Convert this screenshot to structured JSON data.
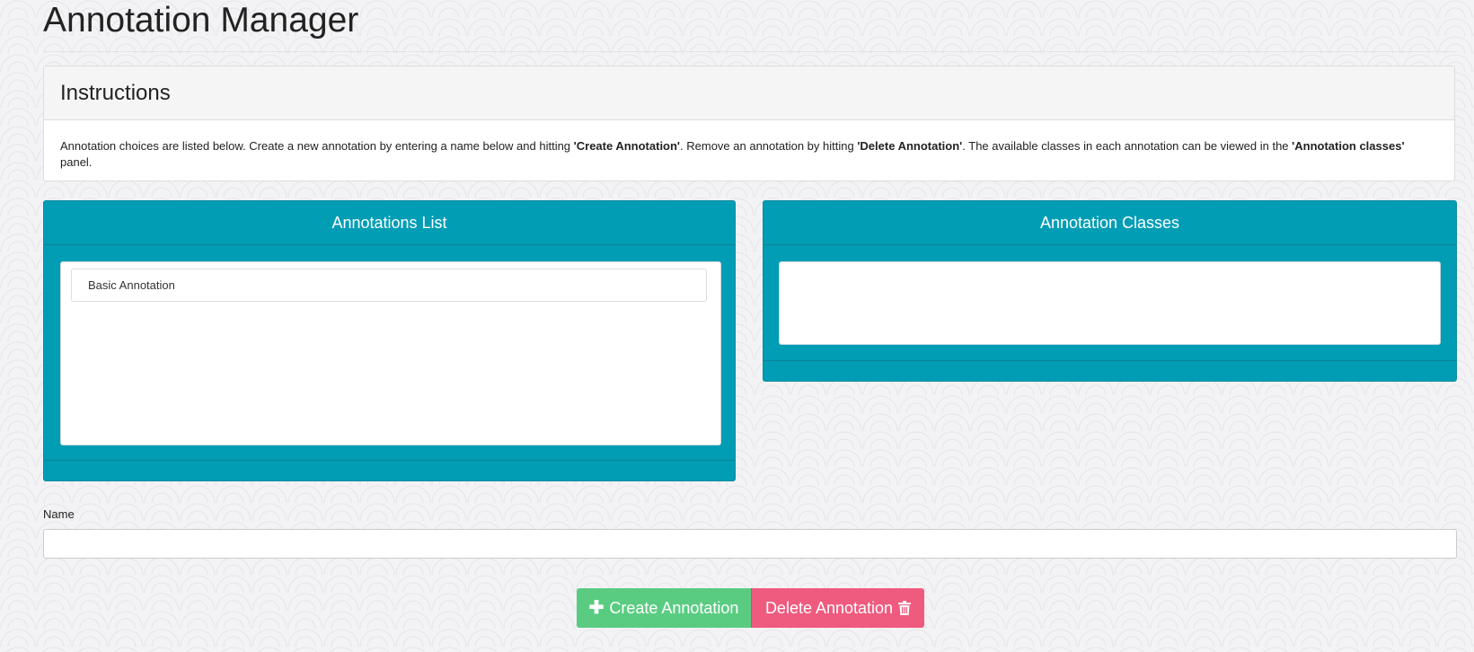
{
  "header": {
    "title": "Annotation Manager"
  },
  "instructions": {
    "title": "Instructions",
    "text_1": "Annotation choices are listed below. Create a new annotation by entering a name below and hitting ",
    "create_bold": "'Create Annotation'",
    "text_2": ". Remove an annotation by hitting ",
    "delete_bold": "'Delete Annotation'",
    "text_3": ". The available classes in each annotation can be viewed in the ",
    "classes_bold": "'Annotation classes'",
    "text_4": " panel."
  },
  "annotations_panel": {
    "title": "Annotations List",
    "items": [
      {
        "label": "Basic Annotation"
      }
    ]
  },
  "classes_panel": {
    "title": "Annotation Classes",
    "items": []
  },
  "name_field": {
    "label": "Name",
    "value": "",
    "placeholder": ""
  },
  "actions": {
    "create_label": "Create Annotation",
    "delete_label": "Delete Annotation"
  },
  "icons": {
    "create": "plus-icon",
    "delete": "trash-icon"
  },
  "colors": {
    "panel_teal": "#009db5",
    "create_green": "#5acc82",
    "delete_pink": "#ef5a7f"
  }
}
